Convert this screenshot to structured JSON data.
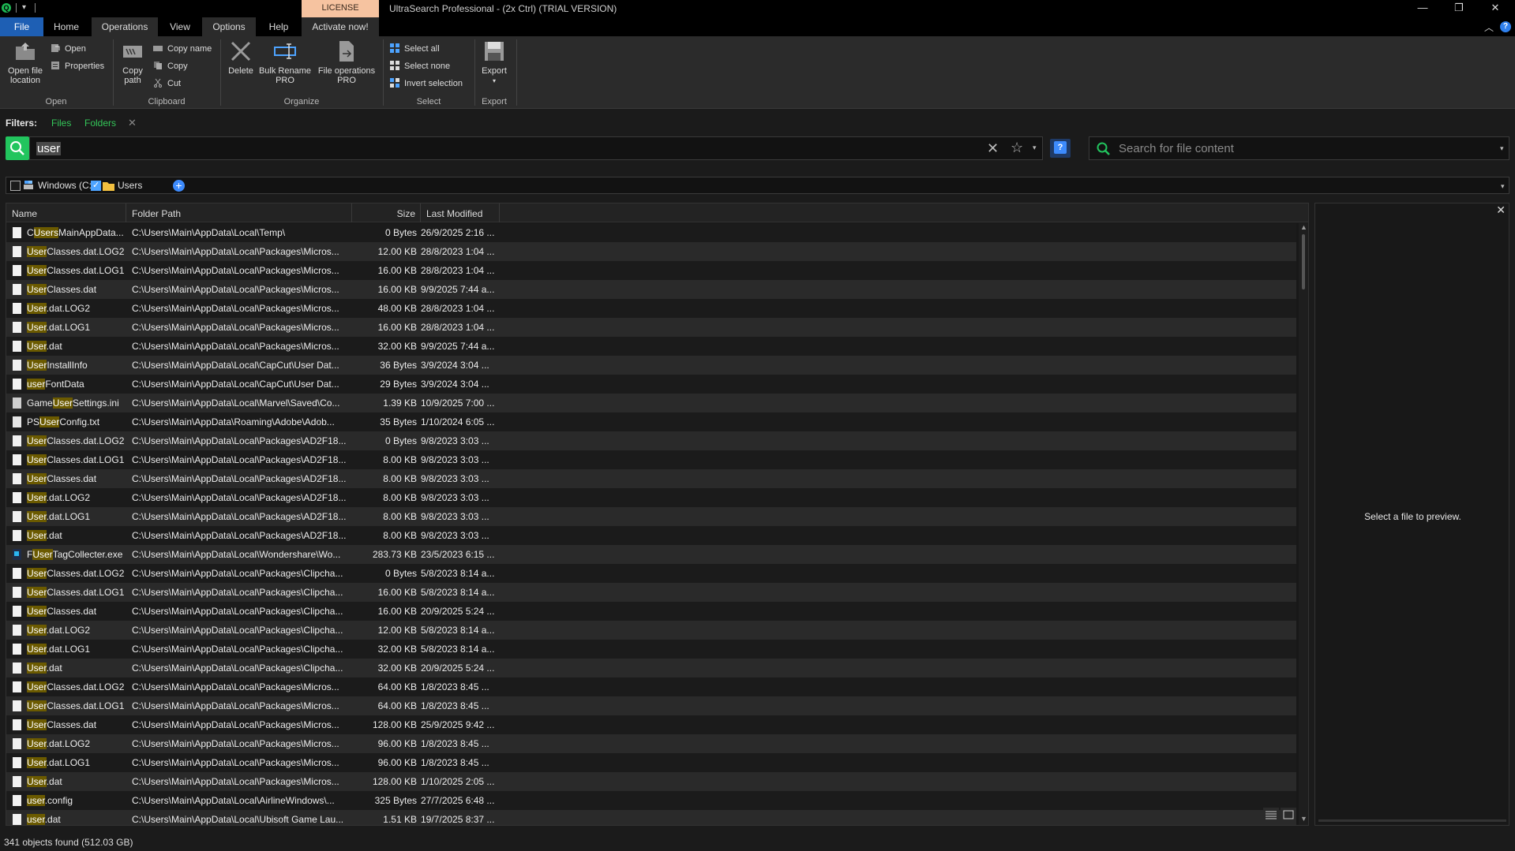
{
  "titlebar": {
    "license_tab": "LICENSE",
    "title": "UltraSearch Professional  -  (2x Ctrl)  (TRIAL VERSION)",
    "minimize": "—",
    "maximize": "❐",
    "close": "✕"
  },
  "ribbon_tabs": [
    "File",
    "Home",
    "Operations",
    "View",
    "Options",
    "Help",
    "Activate now!"
  ],
  "ribbon": {
    "open_group": {
      "label": "Open",
      "open_file_location_1": "Open file",
      "open_file_location_2": "location",
      "open": "Open",
      "properties": "Properties"
    },
    "clipboard_group": {
      "label": "Clipboard",
      "copy_path_1": "Copy",
      "copy_path_2": "path",
      "copy_name": "Copy name",
      "copy": "Copy",
      "cut": "Cut"
    },
    "organize_group": {
      "label": "Organize",
      "delete": "Delete",
      "bulk_rename_1": "Bulk Rename",
      "bulk_rename_2": "PRO",
      "file_ops_1": "File operations",
      "file_ops_2": "PRO"
    },
    "select_group": {
      "label": "Select",
      "select_all": "Select all",
      "select_none": "Select none",
      "invert_selection": "Invert selection"
    },
    "export_group": {
      "label": "Export",
      "export": "Export"
    }
  },
  "filters": {
    "label": "Filters:",
    "files": "Files",
    "folders": "Folders"
  },
  "search": {
    "query": "user",
    "content_placeholder": "Search for file content"
  },
  "locations": [
    {
      "label": "Windows (C:)",
      "checked": false
    },
    {
      "label": "Users",
      "checked": true
    }
  ],
  "table": {
    "columns": [
      "Name",
      "Folder Path",
      "Size",
      "Last Modified"
    ],
    "rows": [
      {
        "icon": "file",
        "pre": "C",
        "hl": "Users",
        "post": "MainAppData...",
        "path": "C:\\Users\\Main\\AppData\\Local\\Temp\\",
        "size": "0 Bytes",
        "modified": "26/9/2025 2:16 ..."
      },
      {
        "icon": "file",
        "pre": "",
        "hl": "User",
        "post": "Classes.dat.LOG2",
        "path": "C:\\Users\\Main\\AppData\\Local\\Packages\\Micros...",
        "size": "12.00 KB",
        "modified": "28/8/2023 1:04 ..."
      },
      {
        "icon": "file",
        "pre": "",
        "hl": "User",
        "post": "Classes.dat.LOG1",
        "path": "C:\\Users\\Main\\AppData\\Local\\Packages\\Micros...",
        "size": "16.00 KB",
        "modified": "28/8/2023 1:04 ..."
      },
      {
        "icon": "file",
        "pre": "",
        "hl": "User",
        "post": "Classes.dat",
        "path": "C:\\Users\\Main\\AppData\\Local\\Packages\\Micros...",
        "size": "16.00 KB",
        "modified": "9/9/2025 7:44 a..."
      },
      {
        "icon": "file",
        "pre": "",
        "hl": "User",
        "post": ".dat.LOG2",
        "path": "C:\\Users\\Main\\AppData\\Local\\Packages\\Micros...",
        "size": "48.00 KB",
        "modified": "28/8/2023 1:04 ..."
      },
      {
        "icon": "file",
        "pre": "",
        "hl": "User",
        "post": ".dat.LOG1",
        "path": "C:\\Users\\Main\\AppData\\Local\\Packages\\Micros...",
        "size": "16.00 KB",
        "modified": "28/8/2023 1:04 ..."
      },
      {
        "icon": "file",
        "pre": "",
        "hl": "User",
        "post": ".dat",
        "path": "C:\\Users\\Main\\AppData\\Local\\Packages\\Micros...",
        "size": "32.00 KB",
        "modified": "9/9/2025 7:44 a..."
      },
      {
        "icon": "file",
        "pre": "",
        "hl": "User",
        "post": "InstallInfo",
        "path": "C:\\Users\\Main\\AppData\\Local\\CapCut\\User Dat...",
        "size": "36 Bytes",
        "modified": "3/9/2024 3:04 ..."
      },
      {
        "icon": "file",
        "pre": "",
        "hl": "user",
        "post": "FontData",
        "path": "C:\\Users\\Main\\AppData\\Local\\CapCut\\User Dat...",
        "size": "29 Bytes",
        "modified": "3/9/2024 3:04 ..."
      },
      {
        "icon": "ini",
        "pre": "Game",
        "hl": "User",
        "post": "Settings.ini",
        "path": "C:\\Users\\Main\\AppData\\Local\\Marvel\\Saved\\Co...",
        "size": "1.39 KB",
        "modified": "10/9/2025 7:00 ..."
      },
      {
        "icon": "txt",
        "pre": "PS",
        "hl": "User",
        "post": "Config.txt",
        "path": "C:\\Users\\Main\\AppData\\Roaming\\Adobe\\Adob...",
        "size": "35 Bytes",
        "modified": "1/10/2024 6:05 ..."
      },
      {
        "icon": "file",
        "pre": "",
        "hl": "User",
        "post": "Classes.dat.LOG2",
        "path": "C:\\Users\\Main\\AppData\\Local\\Packages\\AD2F18...",
        "size": "0 Bytes",
        "modified": "9/8/2023 3:03 ..."
      },
      {
        "icon": "file",
        "pre": "",
        "hl": "User",
        "post": "Classes.dat.LOG1",
        "path": "C:\\Users\\Main\\AppData\\Local\\Packages\\AD2F18...",
        "size": "8.00 KB",
        "modified": "9/8/2023 3:03 ..."
      },
      {
        "icon": "file",
        "pre": "",
        "hl": "User",
        "post": "Classes.dat",
        "path": "C:\\Users\\Main\\AppData\\Local\\Packages\\AD2F18...",
        "size": "8.00 KB",
        "modified": "9/8/2023 3:03 ..."
      },
      {
        "icon": "file",
        "pre": "",
        "hl": "User",
        "post": ".dat.LOG2",
        "path": "C:\\Users\\Main\\AppData\\Local\\Packages\\AD2F18...",
        "size": "8.00 KB",
        "modified": "9/8/2023 3:03 ..."
      },
      {
        "icon": "file",
        "pre": "",
        "hl": "User",
        "post": ".dat.LOG1",
        "path": "C:\\Users\\Main\\AppData\\Local\\Packages\\AD2F18...",
        "size": "8.00 KB",
        "modified": "9/8/2023 3:03 ..."
      },
      {
        "icon": "file",
        "pre": "",
        "hl": "User",
        "post": ".dat",
        "path": "C:\\Users\\Main\\AppData\\Local\\Packages\\AD2F18...",
        "size": "8.00 KB",
        "modified": "9/8/2023 3:03 ..."
      },
      {
        "icon": "exe",
        "pre": "F",
        "hl": "User",
        "post": "TagCollecter.exe",
        "path": "C:\\Users\\Main\\AppData\\Local\\Wondershare\\Wo...",
        "size": "283.73 KB",
        "modified": "23/5/2023 6:15 ..."
      },
      {
        "icon": "file",
        "pre": "",
        "hl": "User",
        "post": "Classes.dat.LOG2",
        "path": "C:\\Users\\Main\\AppData\\Local\\Packages\\Clipcha...",
        "size": "0 Bytes",
        "modified": "5/8/2023 8:14 a..."
      },
      {
        "icon": "file",
        "pre": "",
        "hl": "User",
        "post": "Classes.dat.LOG1",
        "path": "C:\\Users\\Main\\AppData\\Local\\Packages\\Clipcha...",
        "size": "16.00 KB",
        "modified": "5/8/2023 8:14 a..."
      },
      {
        "icon": "file",
        "pre": "",
        "hl": "User",
        "post": "Classes.dat",
        "path": "C:\\Users\\Main\\AppData\\Local\\Packages\\Clipcha...",
        "size": "16.00 KB",
        "modified": "20/9/2025 5:24 ..."
      },
      {
        "icon": "file",
        "pre": "",
        "hl": "User",
        "post": ".dat.LOG2",
        "path": "C:\\Users\\Main\\AppData\\Local\\Packages\\Clipcha...",
        "size": "12.00 KB",
        "modified": "5/8/2023 8:14 a..."
      },
      {
        "icon": "file",
        "pre": "",
        "hl": "User",
        "post": ".dat.LOG1",
        "path": "C:\\Users\\Main\\AppData\\Local\\Packages\\Clipcha...",
        "size": "32.00 KB",
        "modified": "5/8/2023 8:14 a..."
      },
      {
        "icon": "file",
        "pre": "",
        "hl": "User",
        "post": ".dat",
        "path": "C:\\Users\\Main\\AppData\\Local\\Packages\\Clipcha...",
        "size": "32.00 KB",
        "modified": "20/9/2025 5:24 ..."
      },
      {
        "icon": "file",
        "pre": "",
        "hl": "User",
        "post": "Classes.dat.LOG2",
        "path": "C:\\Users\\Main\\AppData\\Local\\Packages\\Micros...",
        "size": "64.00 KB",
        "modified": "1/8/2023 8:45 ..."
      },
      {
        "icon": "file",
        "pre": "",
        "hl": "User",
        "post": "Classes.dat.LOG1",
        "path": "C:\\Users\\Main\\AppData\\Local\\Packages\\Micros...",
        "size": "64.00 KB",
        "modified": "1/8/2023 8:45 ..."
      },
      {
        "icon": "file",
        "pre": "",
        "hl": "User",
        "post": "Classes.dat",
        "path": "C:\\Users\\Main\\AppData\\Local\\Packages\\Micros...",
        "size": "128.00 KB",
        "modified": "25/9/2025 9:42 ..."
      },
      {
        "icon": "file",
        "pre": "",
        "hl": "User",
        "post": ".dat.LOG2",
        "path": "C:\\Users\\Main\\AppData\\Local\\Packages\\Micros...",
        "size": "96.00 KB",
        "modified": "1/8/2023 8:45 ..."
      },
      {
        "icon": "file",
        "pre": "",
        "hl": "User",
        "post": ".dat.LOG1",
        "path": "C:\\Users\\Main\\AppData\\Local\\Packages\\Micros...",
        "size": "96.00 KB",
        "modified": "1/8/2023 8:45 ..."
      },
      {
        "icon": "file",
        "pre": "",
        "hl": "User",
        "post": ".dat",
        "path": "C:\\Users\\Main\\AppData\\Local\\Packages\\Micros...",
        "size": "128.00 KB",
        "modified": "1/10/2025 2:05 ..."
      },
      {
        "icon": "file",
        "pre": "",
        "hl": "user",
        "post": ".config",
        "path": "C:\\Users\\Main\\AppData\\Local\\AirlineWindows\\...",
        "size": "325 Bytes",
        "modified": "27/7/2025 6:48 ..."
      },
      {
        "icon": "file",
        "pre": "",
        "hl": "user",
        "post": ".dat",
        "path": "C:\\Users\\Main\\AppData\\Local\\Ubisoft Game Lau...",
        "size": "1.51 KB",
        "modified": "19/7/2025 8:37 ..."
      }
    ]
  },
  "preview": {
    "message": "Select a file to preview."
  },
  "status": {
    "text": "341 objects found (512.03 GB)"
  },
  "colors": {
    "accent_green": "#22c55e",
    "filter_green": "#34c759",
    "file_tab": "#1e5fb4",
    "license_tab": "#f6c3a0",
    "highlight": "#6b5a00"
  }
}
